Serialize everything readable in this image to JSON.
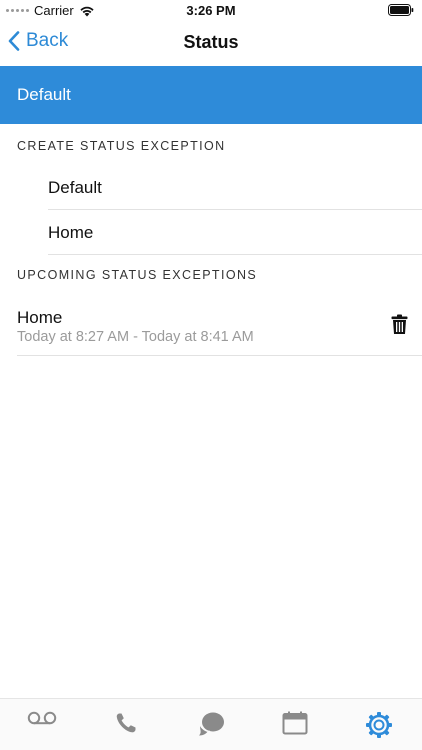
{
  "status_bar": {
    "carrier": "Carrier",
    "time": "3:26 PM"
  },
  "nav": {
    "back_label": "Back",
    "title": "Status"
  },
  "current_status": "Default",
  "create_section": {
    "header": "CREATE STATUS EXCEPTION",
    "options": [
      "Default",
      "Home"
    ]
  },
  "upcoming_section": {
    "header": "UPCOMING STATUS EXCEPTIONS",
    "items": [
      {
        "title": "Home",
        "range": "Today at 8:27 AM - Today at 8:41 AM"
      }
    ]
  },
  "tabs": [
    {
      "icon": "voicemail-icon"
    },
    {
      "icon": "phone-icon"
    },
    {
      "icon": "chat-icon"
    },
    {
      "icon": "calendar-icon"
    },
    {
      "icon": "settings-gear-icon",
      "active": true
    }
  ],
  "colors": {
    "accent": "#2e8bd9",
    "tab_inactive": "#8a8a8a",
    "subtitle": "#9b9b9b"
  }
}
